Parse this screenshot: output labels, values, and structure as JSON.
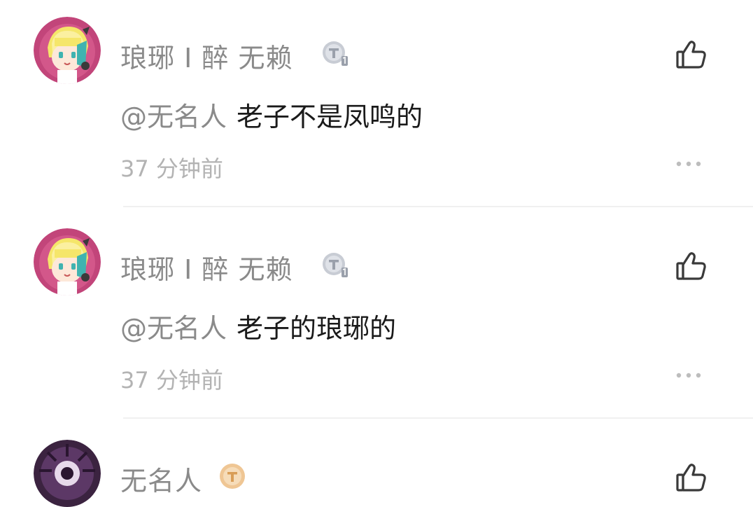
{
  "comments": [
    {
      "username": "琅琊 I 醉 无赖",
      "mention": "@无名人",
      "text": "老子不是凤鸣的",
      "time": "37 分钟前",
      "avatar_icon": "anime-avatar-icon",
      "badge_icon": "silver-t-badge-icon"
    },
    {
      "username": "琅琊 I 醉 无赖",
      "mention": "@无名人",
      "text": "老子的琅琊的",
      "time": "37 分钟前",
      "avatar_icon": "anime-avatar-icon",
      "badge_icon": "silver-t-badge-icon"
    },
    {
      "username": "无名人",
      "avatar_icon": "dark-purple-avatar-icon",
      "badge_icon": "gold-t-badge-icon"
    }
  ],
  "colors": {
    "username": "#8a8a8a",
    "body_text": "#1a1a1a",
    "meta_text": "#b3b3b3",
    "avatar_ring": "#c2457a",
    "gold_badge": "#e9b979"
  }
}
